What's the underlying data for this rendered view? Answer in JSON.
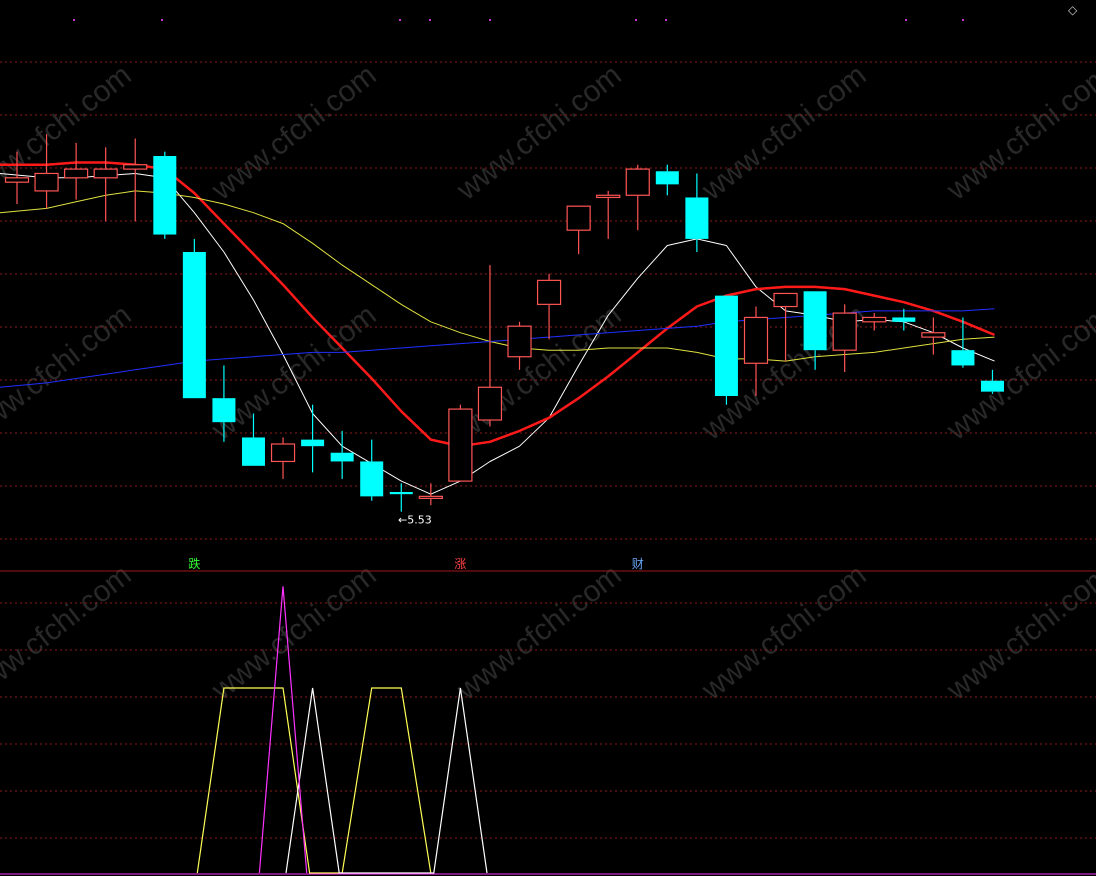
{
  "watermark": "www.cfchi.com",
  "corner_glyph": "◇",
  "colors": {
    "background": "#000000",
    "grid": "#8b1a1a",
    "divider": "#a01818",
    "up_candle": "#ff5555",
    "down_candle": "#00ffff",
    "ma5": "#ffffff",
    "ma10": "#ff1a1a",
    "ma20": "#e0e040",
    "ma60": "#2030ff",
    "marker_magenta": "#cc33cc",
    "ind_yellow": "#ffff55",
    "ind_white": "#ffffff",
    "ind_magenta": "#ff33ff",
    "label_green": "#33ff33",
    "label_red": "#ff4444",
    "label_blue": "#66aaff"
  },
  "main_panel": {
    "low_marker": "←5.53",
    "signal_labels": [
      {
        "text": "跌",
        "color_key": "label_green",
        "bar": 6
      },
      {
        "text": "涨",
        "color_key": "label_red",
        "bar": 15
      },
      {
        "text": "财",
        "color_key": "label_blue",
        "bar": 21
      }
    ]
  },
  "chart_data": [
    {
      "type": "candlestick",
      "price_range": [
        5.4,
        7.6
      ],
      "low_marker_value": 5.53,
      "candles": [
        {
          "o": 7.04,
          "h": 7.18,
          "l": 6.94,
          "c": 7.06
        },
        {
          "o": 7.0,
          "h": 7.26,
          "l": 6.92,
          "c": 7.08
        },
        {
          "o": 7.06,
          "h": 7.22,
          "l": 6.96,
          "c": 7.1
        },
        {
          "o": 7.06,
          "h": 7.2,
          "l": 6.86,
          "c": 7.1
        },
        {
          "o": 7.1,
          "h": 7.24,
          "l": 6.86,
          "c": 7.12
        },
        {
          "o": 7.16,
          "h": 7.18,
          "l": 6.78,
          "c": 6.8
        },
        {
          "o": 6.72,
          "h": 6.78,
          "l": 6.05,
          "c": 6.05
        },
        {
          "o": 6.05,
          "h": 6.2,
          "l": 5.85,
          "c": 5.94
        },
        {
          "o": 5.87,
          "h": 5.98,
          "l": 5.74,
          "c": 5.74
        },
        {
          "o": 5.76,
          "h": 5.87,
          "l": 5.68,
          "c": 5.84
        },
        {
          "o": 5.86,
          "h": 6.02,
          "l": 5.71,
          "c": 5.83
        },
        {
          "o": 5.8,
          "h": 5.9,
          "l": 5.68,
          "c": 5.76
        },
        {
          "o": 5.76,
          "h": 5.86,
          "l": 5.58,
          "c": 5.6
        },
        {
          "o": 5.62,
          "h": 5.66,
          "l": 5.53,
          "c": 5.61
        },
        {
          "o": 5.6,
          "h": 5.66,
          "l": 5.56,
          "c": 5.6
        },
        {
          "o": 5.67,
          "h": 6.02,
          "l": 5.67,
          "c": 6.0
        },
        {
          "o": 5.95,
          "h": 6.66,
          "l": 5.92,
          "c": 6.1
        },
        {
          "o": 6.24,
          "h": 6.4,
          "l": 6.18,
          "c": 6.38
        },
        {
          "o": 6.48,
          "h": 6.62,
          "l": 6.32,
          "c": 6.59
        },
        {
          "o": 6.82,
          "h": 6.91,
          "l": 6.71,
          "c": 6.93
        },
        {
          "o": 6.97,
          "h": 7.0,
          "l": 6.78,
          "c": 6.98
        },
        {
          "o": 6.98,
          "h": 7.12,
          "l": 6.82,
          "c": 7.1
        },
        {
          "o": 7.09,
          "h": 7.12,
          "l": 6.98,
          "c": 7.03
        },
        {
          "o": 6.97,
          "h": 7.08,
          "l": 6.72,
          "c": 6.78
        },
        {
          "o": 6.52,
          "h": 6.52,
          "l": 6.02,
          "c": 6.06
        },
        {
          "o": 6.21,
          "h": 6.47,
          "l": 6.06,
          "c": 6.42
        },
        {
          "o": 6.47,
          "h": 6.53,
          "l": 6.22,
          "c": 6.53
        },
        {
          "o": 6.54,
          "h": 6.54,
          "l": 6.18,
          "c": 6.27
        },
        {
          "o": 6.27,
          "h": 6.48,
          "l": 6.17,
          "c": 6.44
        },
        {
          "o": 6.4,
          "h": 6.44,
          "l": 6.36,
          "c": 6.42
        },
        {
          "o": 6.42,
          "h": 6.46,
          "l": 6.36,
          "c": 6.4
        },
        {
          "o": 6.33,
          "h": 6.42,
          "l": 6.25,
          "c": 6.35
        },
        {
          "o": 6.27,
          "h": 6.42,
          "l": 6.19,
          "c": 6.2
        },
        {
          "o": 6.13,
          "h": 6.18,
          "l": 6.07,
          "c": 6.08
        }
      ],
      "ma_lines": [
        {
          "key": "ma5",
          "values": [
            7.08,
            7.06,
            7.06,
            7.07,
            7.08,
            7.06,
            6.9,
            6.72,
            6.5,
            6.25,
            5.98,
            5.83,
            5.75,
            5.67,
            5.61,
            5.67,
            5.76,
            5.83,
            5.96,
            6.2,
            6.43,
            6.6,
            6.75,
            6.78,
            6.75,
            6.56,
            6.45,
            6.43,
            6.4,
            6.41,
            6.4,
            6.35,
            6.28,
            6.22
          ]
        },
        {
          "key": "ma10",
          "values": [
            7.12,
            7.12,
            7.13,
            7.13,
            7.12,
            7.1,
            6.99,
            6.85,
            6.71,
            6.57,
            6.42,
            6.28,
            6.14,
            5.99,
            5.86,
            5.83,
            5.85,
            5.9,
            5.96,
            6.05,
            6.15,
            6.26,
            6.37,
            6.47,
            6.52,
            6.55,
            6.56,
            6.56,
            6.55,
            6.52,
            6.49,
            6.45,
            6.4,
            6.34
          ]
        },
        {
          "key": "ma20",
          "values": [
            6.9,
            6.92,
            6.95,
            6.98,
            7.0,
            6.99,
            6.97,
            6.94,
            6.9,
            6.85,
            6.76,
            6.66,
            6.57,
            6.48,
            6.4,
            6.35,
            6.31,
            6.28,
            6.27,
            6.27,
            6.28,
            6.28,
            6.28,
            6.26,
            6.23,
            6.23,
            6.22,
            6.24,
            6.25,
            6.26,
            6.28,
            6.3,
            6.32,
            6.33
          ]
        },
        {
          "key": "ma60",
          "values": [
            6.1,
            6.12,
            6.14,
            6.16,
            6.18,
            6.2,
            6.22,
            6.23,
            6.24,
            6.25,
            6.26,
            6.26,
            6.27,
            6.28,
            6.29,
            6.3,
            6.31,
            6.32,
            6.33,
            6.34,
            6.35,
            6.36,
            6.37,
            6.38,
            6.4,
            6.41,
            6.42,
            6.43,
            6.44,
            6.45,
            6.45,
            6.45,
            6.45,
            6.46
          ]
        }
      ]
    },
    {
      "type": "line",
      "y_range": [
        0,
        10
      ],
      "series": [
        {
          "key": "ind_yellow",
          "points": [
            [
              6.1,
              0
            ],
            [
              7.0,
              10
            ],
            [
              9.0,
              10
            ],
            [
              9.9,
              0
            ],
            [
              11.0,
              0
            ],
            [
              12.0,
              10
            ],
            [
              13.0,
              10
            ],
            [
              14.0,
              0
            ]
          ]
        },
        {
          "key": "ind_white",
          "points": [
            [
              9.1,
              0
            ],
            [
              10.0,
              10
            ],
            [
              10.9,
              0
            ],
            [
              14.1,
              0
            ],
            [
              15.0,
              10
            ],
            [
              15.9,
              0
            ]
          ]
        },
        {
          "key": "ind_magenta",
          "points": [
            [
              8.2,
              0
            ],
            [
              9.0,
              15.5
            ],
            [
              9.8,
              0
            ]
          ]
        }
      ]
    }
  ]
}
